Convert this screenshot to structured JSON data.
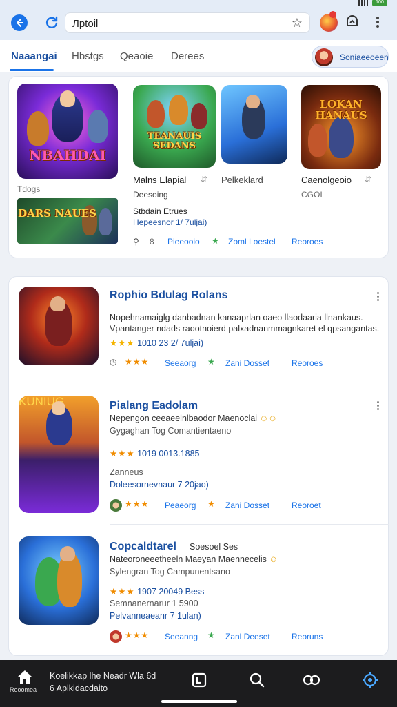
{
  "status_bar": {
    "battery": "100"
  },
  "topbar": {
    "url": "Лptoil",
    "icons": [
      "back-arrow-icon",
      "reload-icon",
      "star-icon",
      "avatar",
      "download-icon",
      "more-icon"
    ]
  },
  "tabs": [
    {
      "label": "Naaangai",
      "active": true
    },
    {
      "label": "Hbstgs",
      "active": false
    },
    {
      "label": "Qeaoie",
      "active": false
    },
    {
      "label": "Derees",
      "active": false
    }
  ],
  "account": {
    "label": "Soniaeeoeen"
  },
  "featured": {
    "hero_label": "NBAHDAI",
    "hero_caption": "Tdogs",
    "banner_label": "DARS NAUES",
    "apps": [
      {
        "art_label": "TEANAUIS SEDANS",
        "title": "Malns Elapial",
        "subtitle": "Deesoing"
      },
      {
        "art_label": "",
        "title": "Pelkeklard",
        "subtitle": ""
      },
      {
        "art_label": "LOKAN HANAUS",
        "title": "Caenolgeoio",
        "subtitle": "CGOI"
      }
    ],
    "detail_line1": "Stbdain Etrues",
    "detail_line2": "Hepeesnor 1/ 7uljai)",
    "actions": {
      "a": "Pieeooio",
      "b": "Zoml Loestel",
      "c": "Reoroes",
      "d": "8"
    }
  },
  "list": [
    {
      "title": "Rophio Bdulag Rolans",
      "desc1": "Nopehnamaiglg danbadnan kanaaprlan oaeo llaodaaria llnankaus.",
      "desc2": "Vpantanger ndads raootnoierd palxadnanmmagnkaret el qpsangantas.",
      "rating": "1010 23 2/ 7uljai)",
      "actions": {
        "a": "Seeaorg",
        "b": "Zani Dosset",
        "c": "Reoroes"
      }
    },
    {
      "title": "Pialang Eadolam",
      "desc1": "Nepengon ceeaeelnlbaodor Maenoclai",
      "desc2": "Gygaghan Tog Comantientaeno",
      "rating": "1019 0013.1885",
      "extra1": "Zanneus",
      "extra2": "Doleesornevnaur 7 20jao)",
      "actions": {
        "a": "Peaeorg",
        "b": "Zani Dosset",
        "c": "Reoroet"
      }
    },
    {
      "title": "Copcaldtarel",
      "title_suffix": "Soesoel Ses",
      "desc1": "Nateoroneeetheeln Maeyan Maennecelis",
      "desc2": "Sylengran Tog Campunentsano",
      "rating": "1907 20049 Bess",
      "extra1": "Semnanernarur 1 5900",
      "extra2": "Pelvanneaeanr 7 1ulan)",
      "actions": {
        "a": "Seeanng",
        "b": "Zanl Deeset",
        "c": "Reoruns"
      }
    }
  ],
  "bottom_nav": {
    "home_label": "Reoomea",
    "text_line1": "Koelikkap lhe Neadr Wla 6d",
    "text_line2": "6 Aplkidacdaito",
    "icons": [
      "home-icon",
      "library-icon",
      "search-icon",
      "loop-icon",
      "settings-icon"
    ]
  }
}
